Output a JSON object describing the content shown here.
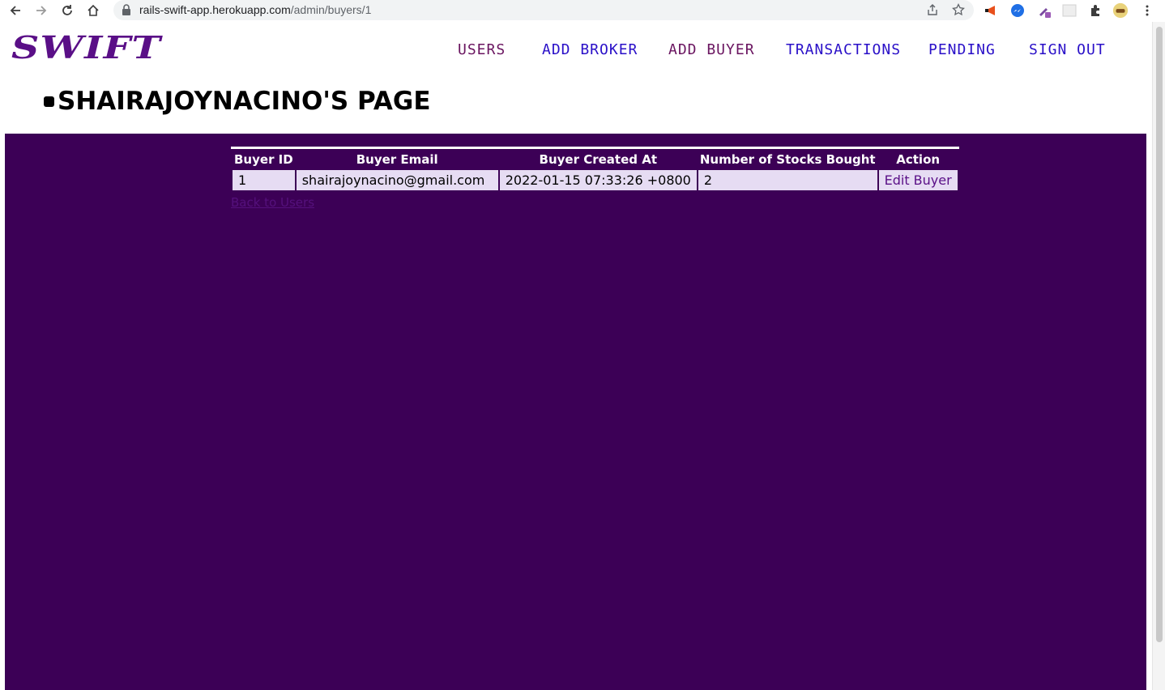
{
  "browser": {
    "url_host": "rails-swift-app.herokuapp.com",
    "url_path": "/admin/buyers/1"
  },
  "app": {
    "logo_text": "SWIFT"
  },
  "nav": [
    {
      "label": "USERS",
      "color": "#6a1560"
    },
    {
      "label": "ADD BROKER",
      "color": "#2a10c8"
    },
    {
      "label": "ADD BUYER",
      "color": "#6a1560"
    },
    {
      "label": "TRANSACTIONS",
      "color": "#2a10c8"
    },
    {
      "label": "PENDING",
      "color": "#2a10c8"
    },
    {
      "label": "SIGN OUT",
      "color": "#2a10c8"
    }
  ],
  "page": {
    "title": "SHAIRAJOYNACINO'S PAGE"
  },
  "table": {
    "headers": [
      "Buyer ID",
      "Buyer Email",
      "Buyer Created At",
      "Number of Stocks Bought",
      "Action"
    ],
    "rows": [
      {
        "buyer_id": "1",
        "buyer_email": "shairajoynacino@gmail.com",
        "created_at": "2022-01-15 07:33:26 +0800",
        "stocks_bought": "2",
        "action_label": "Edit Buyer"
      }
    ]
  },
  "links": {
    "back_label": "Back to Users"
  },
  "colors": {
    "brand_purple": "#5a0f87",
    "content_bg": "#3c0056",
    "cell_bg": "#e6dcf3"
  }
}
